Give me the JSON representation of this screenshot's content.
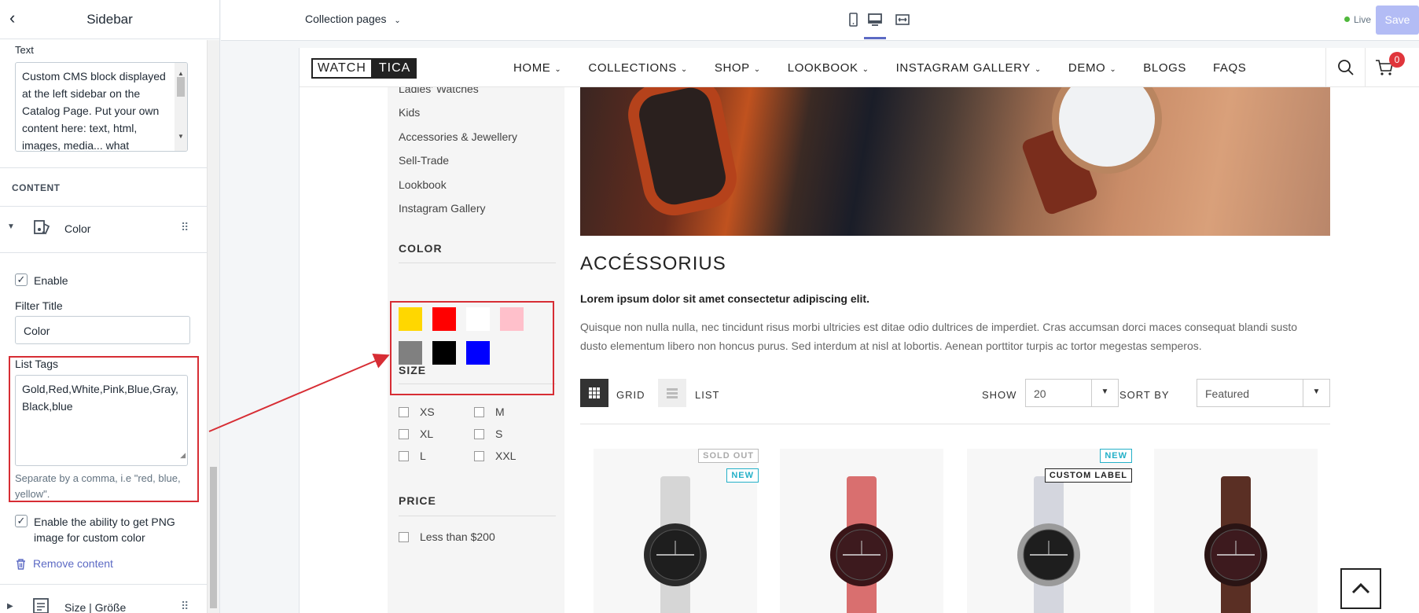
{
  "editor": {
    "back_icon": "chevron-left-icon",
    "title": "Sidebar",
    "text_label": "Text",
    "text_value": "Custom CMS block displayed at the left sidebar on the Catalog Page. Put your own content here: text, html, images, media... what",
    "content_heading": "CONTENT",
    "block_name": "Color",
    "enable_label": "Enable",
    "filter_title_label": "Filter Title",
    "filter_title_value": "Color",
    "list_tags_label": "List Tags",
    "list_tags_value": "Gold,Red,White,Pink,Blue,Gray,Black,blue",
    "list_tags_help": "Separate by a comma, i.e \"red, blue, yellow\".",
    "png_label": "Enable the ability to get PNG image for custom color",
    "remove_label": "Remove content",
    "next_block_name": "Size | Größe"
  },
  "topbar": {
    "page_select": "Collection pages",
    "live_label": "Live",
    "save_label": "Save",
    "devices": [
      "mobile-icon",
      "desktop-icon",
      "fullwidth-icon"
    ],
    "active_device": "desktop-icon"
  },
  "store": {
    "logo_left": "WATCH",
    "logo_right": "TICA",
    "nav": [
      {
        "label": "HOME",
        "dropdown": true
      },
      {
        "label": "COLLECTIONS",
        "dropdown": true
      },
      {
        "label": "SHOP",
        "dropdown": true
      },
      {
        "label": "LOOKBOOK",
        "dropdown": true
      },
      {
        "label": "INSTAGRAM GALLERY",
        "dropdown": true
      },
      {
        "label": "DEMO",
        "dropdown": true
      },
      {
        "label": "BLOGS",
        "dropdown": false
      },
      {
        "label": "FAQS",
        "dropdown": false
      }
    ],
    "cart_count": "0",
    "categories": [
      "Ladies' Watches",
      "Kids",
      "Accessories & Jewellery",
      "Sell-Trade",
      "Lookbook",
      "Instagram Gallery"
    ],
    "color_title": "COLOR",
    "swatches": [
      "#FFD700",
      "#FF0000",
      "#FFFFFF",
      "#FFC0CB",
      "#808080",
      "#000000",
      "#0000FF"
    ],
    "size_title": "SIZE",
    "sizes": [
      "XS",
      "M",
      "XL",
      "S",
      "L",
      "XXL"
    ],
    "price_title": "PRICE",
    "price_first": "Less than $200",
    "collection_title": "ACCÉSSORIUS",
    "lead": "Lorem ipsum dolor sit amet consectetur adipiscing elit.",
    "description": "Quisque non nulla nulla, nec tincidunt risus morbi ultricies est ditae odio dultrices de imperdiet. Cras accumsan dorci maces consequat blandi susto dusto elementum libero non honcus purus. Sed interdum at nisl at lobortis. Aenean porttitor turpis ac tortor megestas semperos.",
    "grid_label": "GRID",
    "list_label": "LIST",
    "show_label": "SHOW",
    "show_value": "20",
    "sort_label": "SORT BY",
    "sort_value": "Featured",
    "products": [
      {
        "badges": [
          "SOLD OUT",
          "NEW"
        ],
        "strap": "#d6d6d6",
        "case": "#2a2a2a",
        "face": "#1e1e1e"
      },
      {
        "badges": [],
        "strap": "#d96f6f",
        "case": "#3a1518",
        "face": "#3d1a1e"
      },
      {
        "badges": [
          "NEW",
          "CUSTOM LABEL"
        ],
        "strap": "#d4d6de",
        "case": "#9a9a9a",
        "face": "#1e1e1e"
      },
      {
        "badges": [],
        "strap": "#5a2f24",
        "case": "#2a1414",
        "face": "#3d1a1e"
      }
    ]
  },
  "colors": {
    "accent": "#5c6ac4",
    "annotation": "#d72d34"
  }
}
